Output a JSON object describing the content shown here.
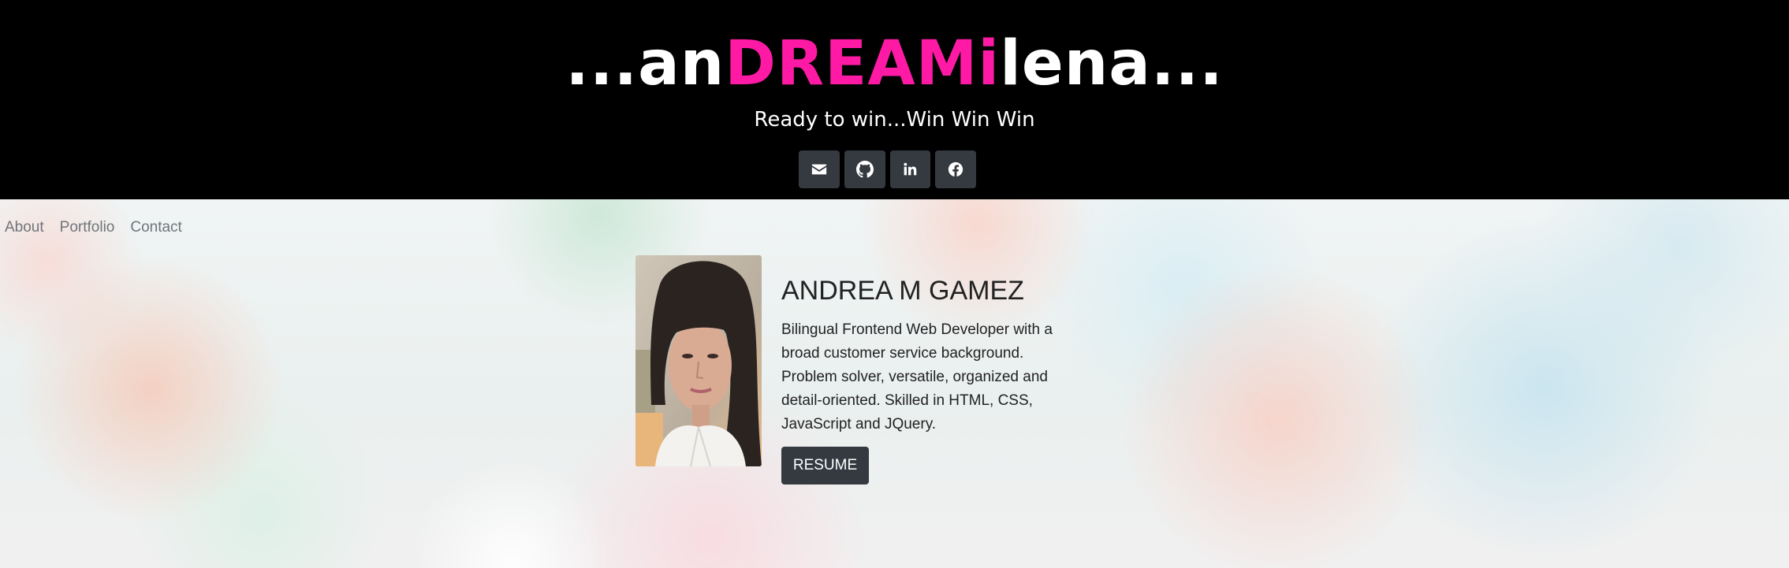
{
  "header": {
    "brand_prefix": "...an",
    "brand_highlight": "DREAMi",
    "brand_suffix": "lena...",
    "tagline": "Ready to win...Win Win Win",
    "accent_color": "#ff1aa6",
    "social_links": [
      {
        "icon": "envelope-icon"
      },
      {
        "icon": "github-icon"
      },
      {
        "icon": "linkedin-icon"
      },
      {
        "icon": "facebook-icon"
      }
    ]
  },
  "nav": {
    "items": [
      "About",
      "Portfolio",
      "Contact"
    ]
  },
  "profile": {
    "name": "ANDREA M GAMEZ",
    "bio": "Bilingual Frontend Web Developer with a broad customer service background. Problem solver, versatile, organized and detail-oriented. Skilled in HTML, CSS, JavaScript and JQuery.",
    "resume_label": "RESUME"
  }
}
